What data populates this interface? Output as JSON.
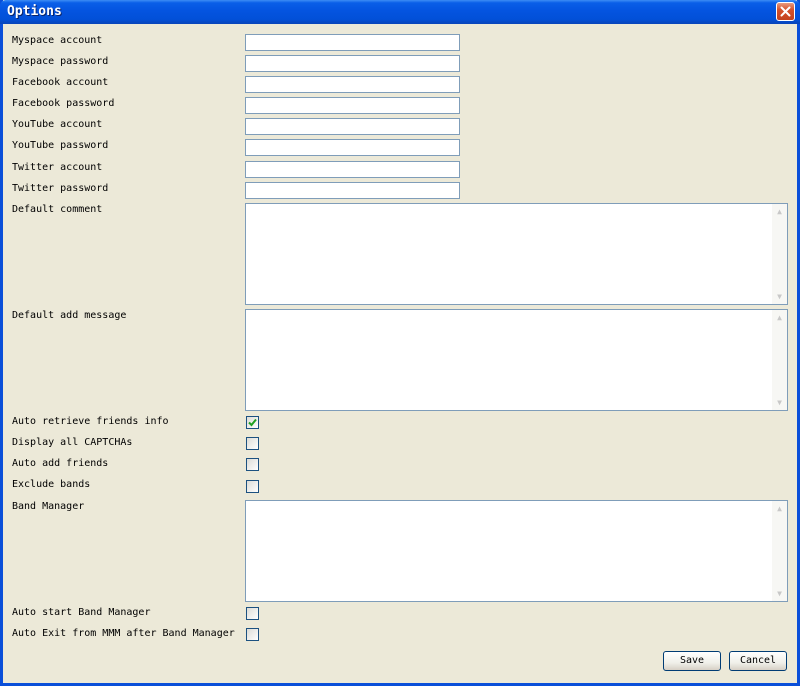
{
  "window": {
    "title": "Options"
  },
  "fields": [
    {
      "label": "Myspace account",
      "value": ""
    },
    {
      "label": "Myspace password",
      "value": ""
    },
    {
      "label": "Facebook account",
      "value": ""
    },
    {
      "label": "Facebook password",
      "value": ""
    },
    {
      "label": "YouTube account",
      "value": ""
    },
    {
      "label": "YouTube password",
      "value": ""
    },
    {
      "label": "Twitter account",
      "value": ""
    },
    {
      "label": "Twitter password",
      "value": ""
    }
  ],
  "textareas": {
    "default_comment": {
      "label": "Default comment",
      "value": ""
    },
    "default_add_message": {
      "label": "Default add message",
      "value": ""
    },
    "band_manager": {
      "label": "Band Manager",
      "value": ""
    }
  },
  "checkboxes": [
    {
      "label": "Auto retrieve friends info",
      "checked": true
    },
    {
      "label": "Display all CAPTCHAs",
      "checked": false
    },
    {
      "label": "Auto add friends",
      "checked": false
    },
    {
      "label": "Exclude bands",
      "checked": false
    },
    {
      "label": "Auto start Band Manager",
      "checked": false
    },
    {
      "label": "Auto Exit from MMM after Band Manager",
      "checked": false
    }
  ],
  "buttons": {
    "save": "Save",
    "cancel": "Cancel"
  },
  "icons": {
    "close": "close-icon",
    "check": "checkmark-icon",
    "scroll_up": "scroll-up-arrow-icon",
    "scroll_down": "scroll-down-arrow-icon"
  },
  "colors": {
    "titlebar": "#0454e0",
    "face": "#ece9d8",
    "check": "#21a121",
    "close": "#d4512b"
  }
}
